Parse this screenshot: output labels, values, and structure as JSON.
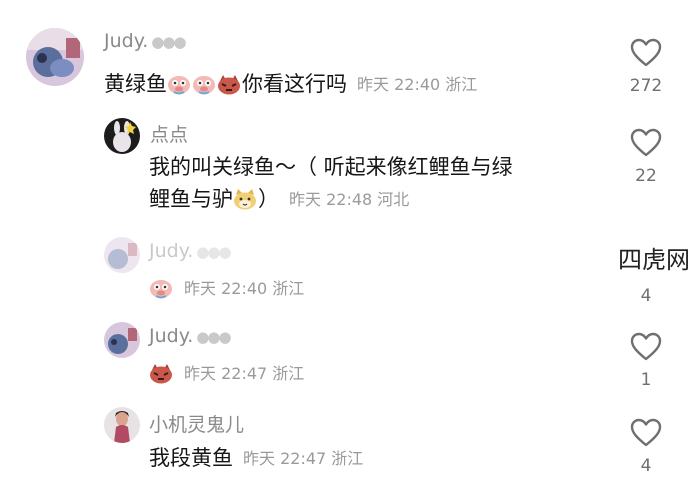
{
  "comments": [
    {
      "user": "Judy.",
      "text": "黄绿鱼",
      "text2": "你看这行吗",
      "time": "昨天 22:40",
      "location": "浙江",
      "likes": "272",
      "emoji": [
        "pig-emoji",
        "pig-emoji",
        "red-face-emoji"
      ]
    },
    {
      "user": "点点",
      "text": "我的叫关绿鱼～（ 听起来像红鲤鱼与绿",
      "text2": "鲤鱼与驴",
      "text3": "）",
      "time": "昨天 22:48",
      "location": "河北",
      "likes": "22",
      "emoji": [
        "cat-emoji"
      ]
    },
    {
      "user": "Judy.",
      "time": "昨天 22:40",
      "location": "浙江",
      "likes": "4",
      "emoji": [
        "pig-emoji"
      ]
    },
    {
      "user": "Judy.",
      "time": "昨天 22:47",
      "location": "浙江",
      "likes": "1",
      "emoji": [
        "red-face-emoji"
      ]
    },
    {
      "user": "小机灵鬼儿",
      "text": "我段黄鱼",
      "time": "昨天 22:47",
      "location": "浙江",
      "likes": "4"
    }
  ],
  "watermark": "四虎网",
  "colors": {
    "text": "#161616",
    "meta": "#9a9a9a",
    "username": "#8a8a8a",
    "heart": "#6f6f6f"
  }
}
